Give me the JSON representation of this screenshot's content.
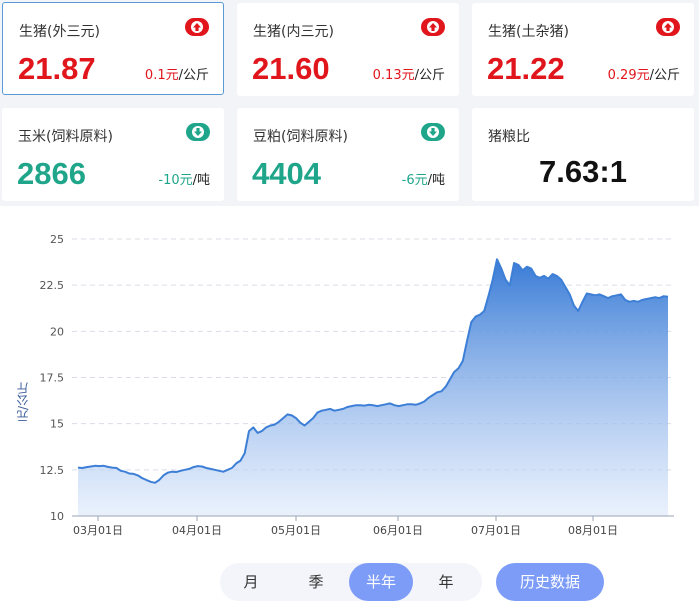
{
  "cards": [
    {
      "title": "生猪(外三元)",
      "price": "21.87",
      "change_value": "0.1元",
      "change_unit": "/公斤",
      "trend": "up",
      "trend_icon": "arrow-up-icon"
    },
    {
      "title": "生猪(内三元)",
      "price": "21.60",
      "change_value": "0.13元",
      "change_unit": "/公斤",
      "trend": "up",
      "trend_icon": "arrow-up-icon"
    },
    {
      "title": "生猪(土杂猪)",
      "price": "21.22",
      "change_value": "0.29元",
      "change_unit": "/公斤",
      "trend": "up",
      "trend_icon": "arrow-up-icon"
    },
    {
      "title": "玉米(饲料原料)",
      "price": "2866",
      "change_value": "-10元",
      "change_unit": "/吨",
      "trend": "down",
      "trend_icon": "arrow-down-icon"
    },
    {
      "title": "豆粕(饲料原料)",
      "price": "4404",
      "change_value": "-6元",
      "change_unit": "/吨",
      "trend": "down",
      "trend_icon": "arrow-down-icon"
    },
    {
      "title": "猪粮比",
      "value": "7.63:1"
    }
  ],
  "colors": {
    "up": "#e0161c",
    "down": "#1fa58a",
    "accent": "#7d9cf7",
    "line": "#3d7fd6"
  },
  "periods": {
    "month": "月",
    "quarter": "季",
    "half_year": "半年",
    "year": "年",
    "selected": "半年"
  },
  "history_button": "历史数据",
  "chart_data": {
    "type": "area",
    "ylabel": "元/公斤",
    "ylim": [
      10,
      25
    ],
    "yticks": [
      "25",
      "22.5",
      "20",
      "17.5",
      "15",
      "12.5",
      "10"
    ],
    "xticks": [
      "03月01日",
      "04月01日",
      "05月01日",
      "06月01日",
      "07月01日",
      "08月01日"
    ],
    "x_start": "02月27日",
    "x_end": "08月25日",
    "grid": "horizontal dashed",
    "series": [
      {
        "values": [
          12.62,
          12.6,
          12.65,
          12.68,
          12.72,
          12.7,
          12.72,
          12.66,
          12.62,
          12.6,
          12.45,
          12.4,
          12.3,
          12.28,
          12.2,
          12.05,
          11.95,
          11.85,
          11.8,
          11.95,
          12.2,
          12.35,
          12.4,
          12.38,
          12.45,
          12.5,
          12.55,
          12.65,
          12.7,
          12.68,
          12.6,
          12.55,
          12.5,
          12.45,
          12.4,
          12.5,
          12.6,
          12.85,
          13.0,
          13.4,
          14.6,
          14.8,
          14.5,
          14.6,
          14.8,
          14.9,
          14.95,
          15.1,
          15.3,
          15.5,
          15.45,
          15.3,
          15.05,
          14.9,
          15.1,
          15.3,
          15.6,
          15.7,
          15.75,
          15.8,
          15.7,
          15.75,
          15.8,
          15.9,
          15.95,
          16.0,
          16.0,
          15.98,
          16.02,
          16.0,
          15.95,
          16.0,
          16.05,
          16.1,
          16.0,
          15.95,
          16.0,
          16.05,
          16.05,
          16.02,
          16.1,
          16.2,
          16.4,
          16.55,
          16.7,
          16.75,
          17.0,
          17.4,
          17.8,
          18.0,
          18.4,
          19.5,
          20.5,
          20.8,
          20.9,
          21.1,
          21.9,
          22.8,
          23.9,
          23.4,
          22.8,
          22.5,
          23.7,
          23.6,
          23.3,
          23.5,
          23.4,
          23.0,
          22.9,
          23.0,
          22.85,
          23.1,
          23.0,
          22.8,
          22.4,
          22.0,
          21.4,
          21.1,
          21.6,
          22.05,
          22.0,
          21.95,
          22.0,
          21.9,
          21.8,
          21.9,
          21.95,
          22.0,
          21.7,
          21.6,
          21.65,
          21.6,
          21.7,
          21.75,
          21.8,
          21.85,
          21.8,
          21.9,
          21.87
        ]
      }
    ]
  }
}
